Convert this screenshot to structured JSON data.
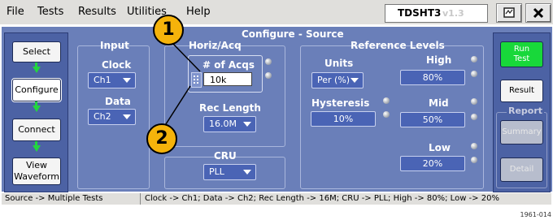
{
  "menubar": {
    "items": [
      "File",
      "Tests",
      "Results",
      "Utilities",
      "Help"
    ],
    "model": "TDSHT3",
    "version": "v1.3"
  },
  "nav": {
    "select": "Select",
    "configure": "Configure",
    "connect": "Connect",
    "view_waveform": "View\nWaveform"
  },
  "right": {
    "run_test": "Run\nTest",
    "result": "Result",
    "report_title": "Report",
    "summary": "Summary",
    "detail": "Detail"
  },
  "configure": {
    "title": "Configure - Source",
    "input": {
      "title": "Input",
      "clock_label": "Clock",
      "clock_value": "Ch1",
      "data_label": "Data",
      "data_value": "Ch2"
    },
    "horiz": {
      "title": "Horiz/Acq",
      "acqs_label": "# of Acqs",
      "acqs_value": "10k",
      "rec_length_label": "Rec Length",
      "rec_length_value": "16.0M"
    },
    "cru": {
      "title": "CRU",
      "value": "PLL"
    },
    "reference": {
      "title": "Reference Levels",
      "units_label": "Units",
      "units_value": "Per (%)",
      "hysteresis_label": "Hysteresis",
      "hysteresis_value": "10%",
      "high_label": "High",
      "high_value": "80%",
      "mid_label": "Mid",
      "mid_value": "50%",
      "low_label": "Low",
      "low_value": "20%"
    }
  },
  "callouts": [
    "1",
    "2"
  ],
  "status": {
    "left": "Source -> Multiple Tests",
    "right": "Clock -> Ch1; Data -> Ch2; Rec Length -> 16M; CRU -> PLL; High -> 80%; Low -> 20%"
  },
  "figure_number": "1961-014"
}
